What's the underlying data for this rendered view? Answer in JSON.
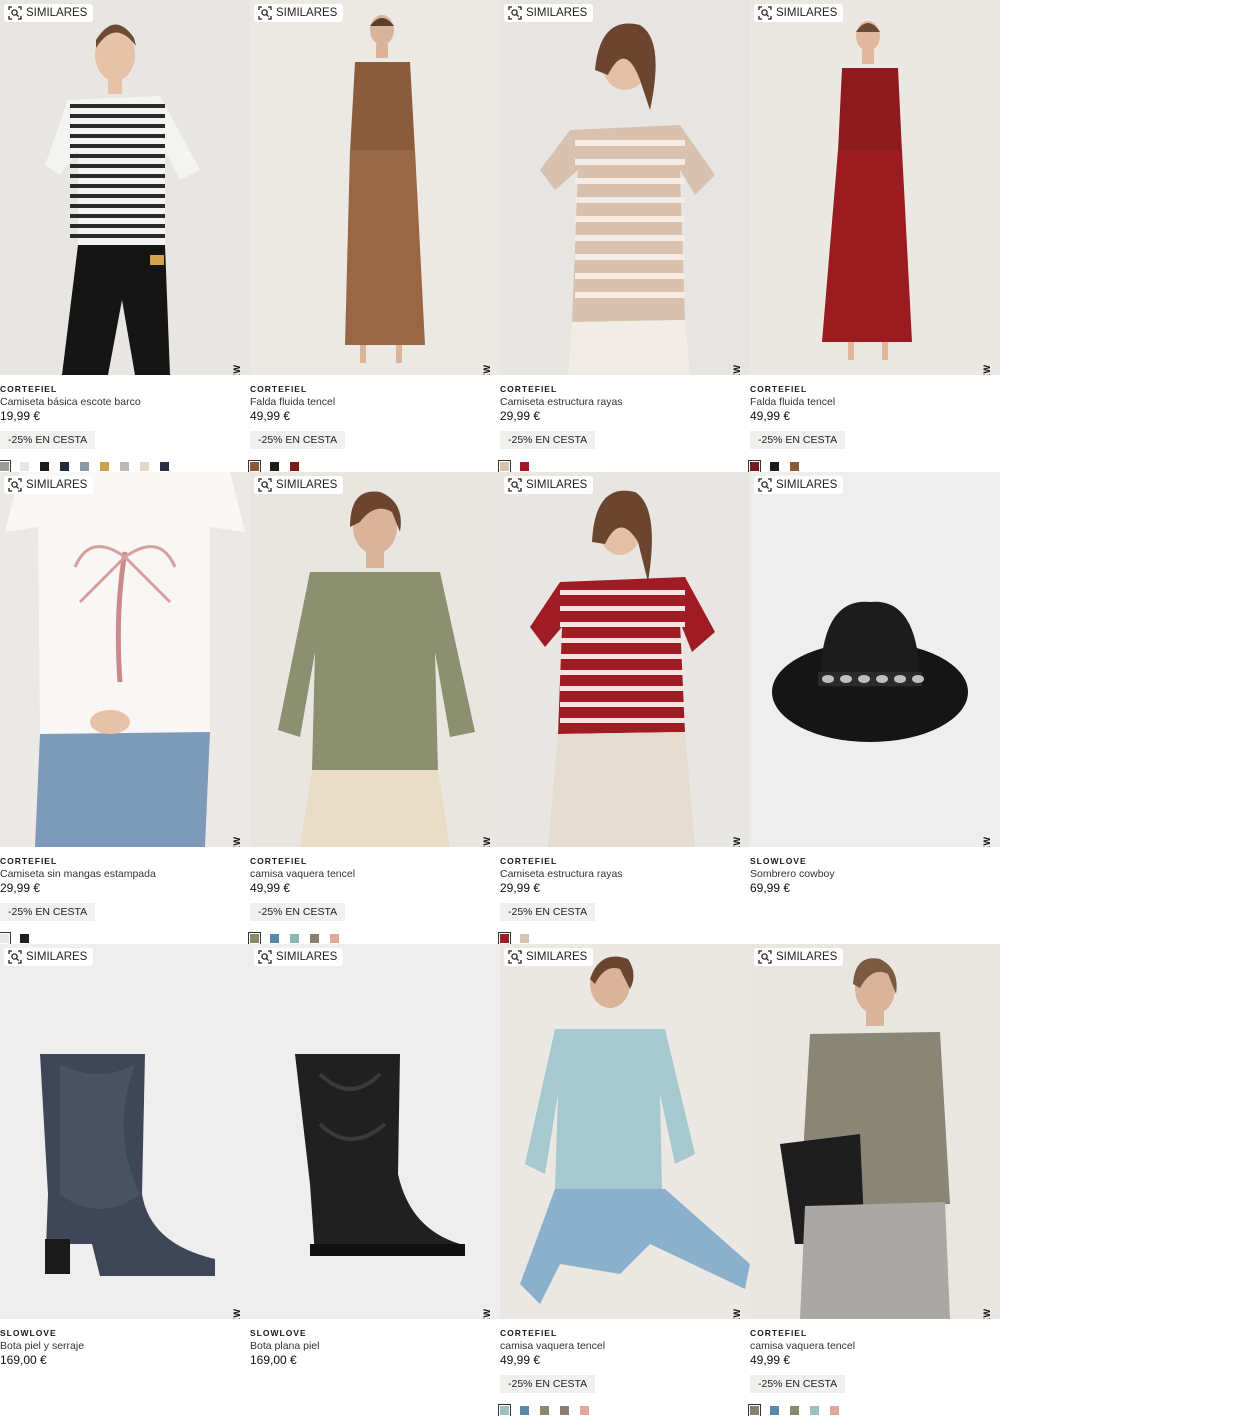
{
  "similar_label": "SIMILARES",
  "new_label": "NEW",
  "products": [
    {
      "brand": "CORTEFIEL",
      "name": "Camiseta básica escote barco",
      "price": "19,99 €",
      "promo": "-25% EN CESTA",
      "bg": "#e8e6e3",
      "garment": "stripes-tee",
      "swatches": [
        "#9a9a9a",
        "#e6e6e6",
        "#1c1c1c",
        "#1e2a3a",
        "#8a98a8",
        "#c9a24a",
        "#b8b8b8",
        "#e2d6c4",
        "#2a2f48"
      ]
    },
    {
      "brand": "CORTEFIEL",
      "name": "Falda fluida tencel",
      "price": "49,99 €",
      "promo": "-25% EN CESTA",
      "bg": "#ece9e5",
      "garment": "brown-set",
      "swatches": [
        "#8a5a3a",
        "#1c1c1c",
        "#7a1a1a"
      ]
    },
    {
      "brand": "CORTEFIEL",
      "name": "Camiseta estructura rayas",
      "price": "29,99 €",
      "promo": "-25% EN CESTA",
      "bg": "#e7e5e2",
      "garment": "beige-stripes",
      "swatches": [
        "#d8c2b0",
        "#a01c24"
      ]
    },
    {
      "brand": "CORTEFIEL",
      "name": "Falda fluida tencel",
      "price": "49,99 €",
      "promo": "-25% EN CESTA",
      "bg": "#ebe8e4",
      "garment": "red-set",
      "swatches": [
        "#7a1a1a",
        "#1c1c1c",
        "#8a5a3a"
      ]
    },
    {
      "brand": "CORTEFIEL",
      "name": "Camiseta sin mangas estampada",
      "price": "29,99 €",
      "promo": "-25% EN CESTA",
      "bg": "#ece8e6",
      "garment": "palm-tee",
      "swatches": [
        "#e8e8e8",
        "#1c1c1c"
      ]
    },
    {
      "brand": "CORTEFIEL",
      "name": "camisa vaquera tencel",
      "price": "49,99 €",
      "promo": "-25% EN CESTA",
      "bg": "#e9e6e1",
      "garment": "olive-shirt",
      "swatches": [
        "#8a8a6a",
        "#5a8aa8",
        "#8ab8b8",
        "#8a8070",
        "#e0a898"
      ]
    },
    {
      "brand": "CORTEFIEL",
      "name": "Camiseta estructura rayas",
      "price": "29,99 €",
      "promo": "-25% EN CESTA",
      "bg": "#e8e6e3",
      "garment": "red-stripes",
      "swatches": [
        "#a01c24",
        "#d8c2b0"
      ]
    },
    {
      "brand": "SLOWLOVE",
      "name": "Sombrero cowboy",
      "price": "69,99 €",
      "promo": "",
      "bg": "#eeeeef",
      "garment": "hat",
      "swatches": []
    },
    {
      "brand": "SLOWLOVE",
      "name": "Bota piel y serraje",
      "price": "169,00 €",
      "promo": "",
      "bg": "#eeeeef",
      "garment": "boot-navy",
      "swatches": []
    },
    {
      "brand": "SLOWLOVE",
      "name": "Bota plana piel",
      "price": "169,00 €",
      "promo": "",
      "bg": "#eeeeef",
      "garment": "boot-black",
      "swatches": []
    },
    {
      "brand": "CORTEFIEL",
      "name": "camisa vaquera tencel",
      "price": "49,99 €",
      "promo": "-25% EN CESTA",
      "bg": "#ebe8e4",
      "garment": "blue-shirt",
      "swatches": [
        "#9ac0c0",
        "#5a8aa8",
        "#8a8a6a",
        "#8a8070",
        "#e0a898"
      ]
    },
    {
      "brand": "CORTEFIEL",
      "name": "camisa vaquera tencel",
      "price": "49,99 €",
      "promo": "-25% EN CESTA",
      "bg": "#e9e6e2",
      "garment": "grey-shirt",
      "swatches": [
        "#8a8070",
        "#5a8aa8",
        "#8a8a6a",
        "#9ac0c0",
        "#e0a898"
      ]
    }
  ]
}
